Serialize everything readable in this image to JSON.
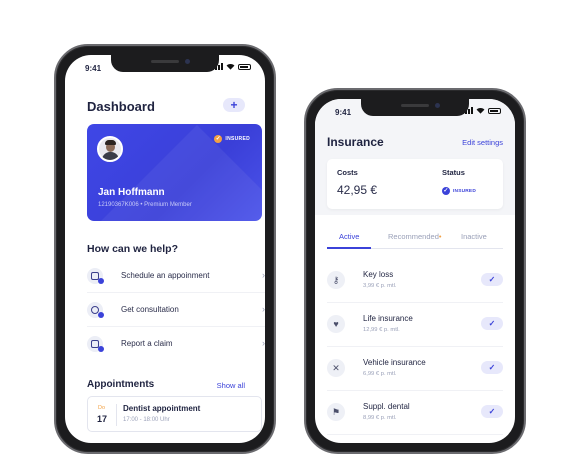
{
  "left": {
    "time": "9:41",
    "title": "Dashboard",
    "add_label": "+",
    "card": {
      "badge": "INSURED",
      "badge_check": "✓",
      "name": "Jan Hoffmann",
      "subtitle": "12190367K006 • Premium Member",
      "color": "#3f47e6"
    },
    "help_title": "How can we help?",
    "help_items": [
      {
        "label": "Schedule an appoinment",
        "chevron": "›"
      },
      {
        "label": "Get consultation",
        "chevron": "›"
      },
      {
        "label": "Report a claim",
        "chevron": "›"
      }
    ],
    "appointments_title": "Appointments",
    "show_all": "Show all",
    "appointment": {
      "month": "Do",
      "day": "17",
      "name": "Dentist appointment",
      "time": "17:00 - 18:00 Uhr"
    }
  },
  "right": {
    "time": "9:41",
    "title": "Insurance",
    "edit": "Edit settings",
    "costs_label": "Costs",
    "costs_value": "42,95 €",
    "status_label": "Status",
    "status_badge": "INSURED",
    "status_check": "✓",
    "tabs": [
      {
        "label": "Active"
      },
      {
        "label": "Recommended"
      },
      {
        "label": "Inactive"
      }
    ],
    "tab_dot": "•",
    "items": [
      {
        "name": "Key loss",
        "price": "3,99 € p. mtl.",
        "icon": "key-icon",
        "glyph": "⚷",
        "check": "✓"
      },
      {
        "name": "Life insurance",
        "price": "12,99 € p. mtl.",
        "icon": "heart-hand-icon",
        "glyph": "♥",
        "check": "✓"
      },
      {
        "name": "Vehicle insurance",
        "price": "6,99 € p. mtl.",
        "icon": "tools-icon",
        "glyph": "✕",
        "check": "✓"
      },
      {
        "name": "Suppl. dental",
        "price": "8,99 € p. mtl.",
        "icon": "tooth-icon",
        "glyph": "⚑",
        "check": "✓"
      }
    ]
  },
  "colors": {
    "accent": "#3b42d9",
    "badge_orange": "#f2a144"
  }
}
